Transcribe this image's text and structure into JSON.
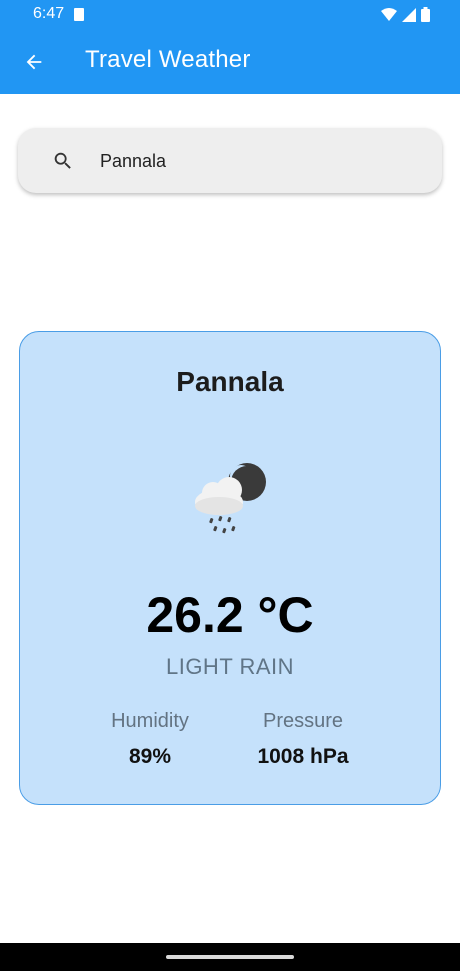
{
  "status_bar": {
    "time": "6:47",
    "icons": [
      "sim-card-icon",
      "wifi-icon",
      "signal-icon",
      "battery-icon"
    ]
  },
  "app_bar": {
    "title": "Travel Weather",
    "back_icon": "arrow-left-icon",
    "color": "#2196f3"
  },
  "search": {
    "value": "Pannala",
    "icon": "search-icon"
  },
  "weather": {
    "city": "Pannala",
    "icon": "rain-cloud-night-icon",
    "temperature": "26.2 °C",
    "condition": "LIGHT RAIN",
    "humidity_label": "Humidity",
    "humidity_value": "89%",
    "pressure_label": "Pressure",
    "pressure_value": "1008 hPa",
    "card_color": "#c5e1fb"
  }
}
